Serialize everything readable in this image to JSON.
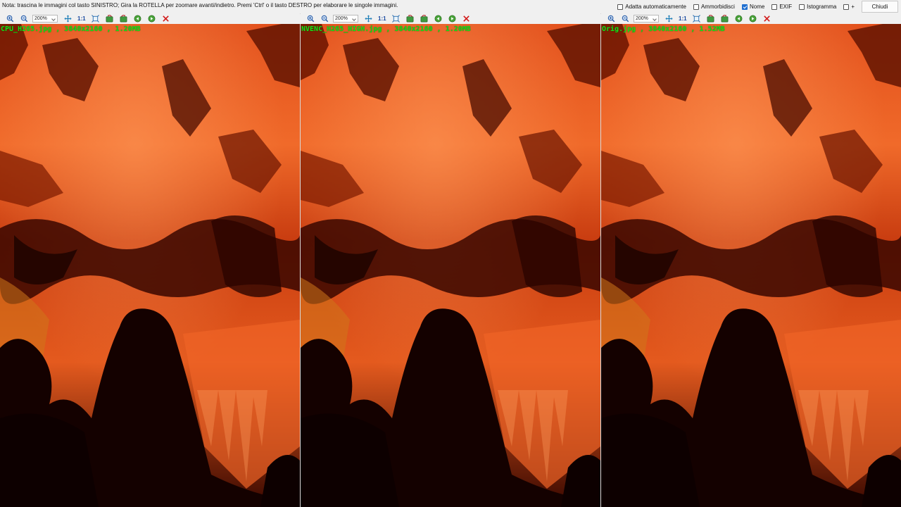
{
  "note": "Nota: trascina le immagini col tasto SINISTRO; Gira la ROTELLA per zoomare avanti/indietro. Premi 'Ctrl' o il tasto DESTRO per elaborare le singole immagini.",
  "options": [
    {
      "label": "Adatta automaticamente",
      "checked": false
    },
    {
      "label": "Ammorbidisci",
      "checked": false
    },
    {
      "label": "Nome",
      "checked": true
    },
    {
      "label": "EXIF",
      "checked": false
    },
    {
      "label": "Istogramma",
      "checked": false
    },
    {
      "label": "+",
      "checked": false
    }
  ],
  "close_label": "Chiudi",
  "toolbar": {
    "zoom": "200%",
    "one_to_one": "1:1"
  },
  "panels": [
    {
      "caption": "CPU_H265.jpg , 3840x2160 , 1.20MB"
    },
    {
      "caption": "NVENC_H265_HIGH.jpg , 3840x2160 , 1.20MB"
    },
    {
      "caption": "Orig.jpg , 3840x2160 , 1.52MB"
    }
  ],
  "icons": [
    "zoom-in-icon",
    "zoom-out-icon",
    "move-icon",
    "fit-icon",
    "rotate-left-icon",
    "rotate-right-icon",
    "previous-icon",
    "next-icon",
    "close-icon"
  ]
}
